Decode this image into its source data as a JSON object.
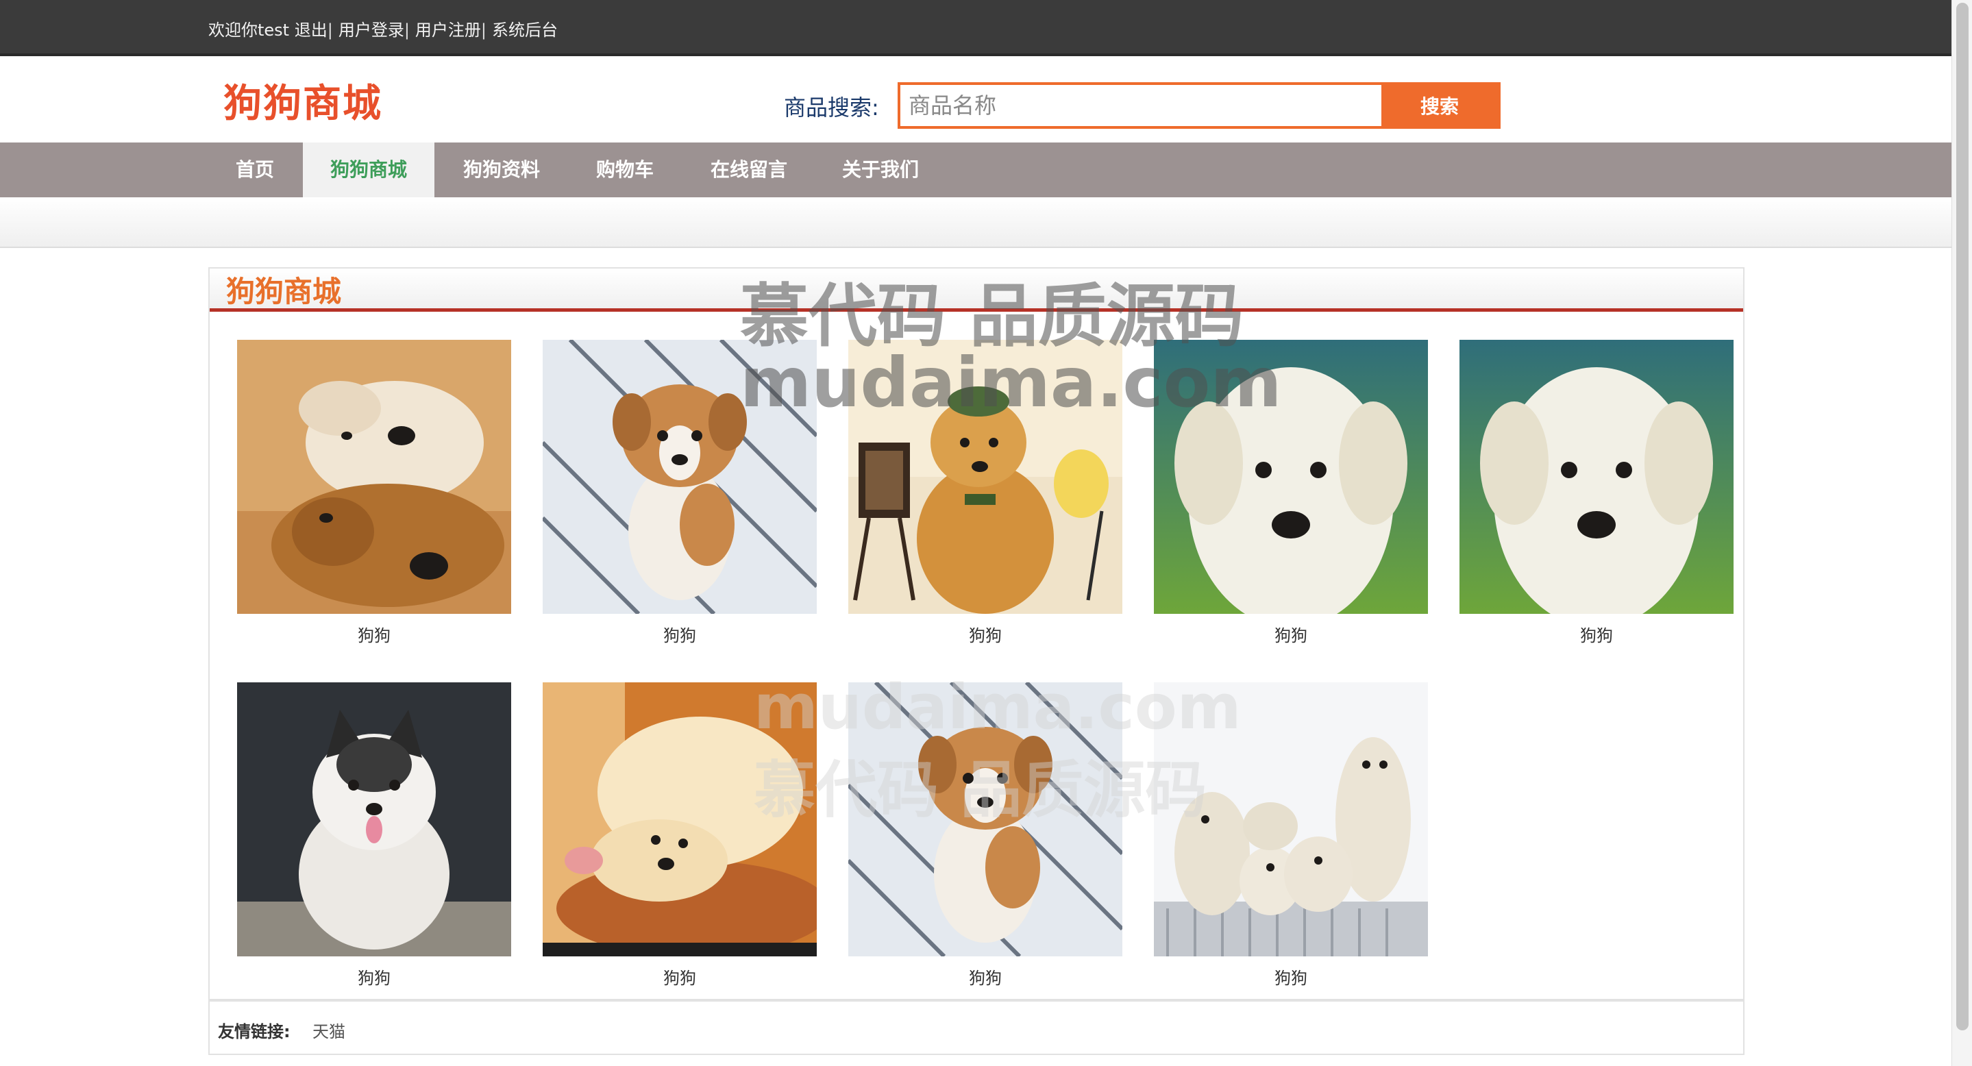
{
  "topbar": {
    "welcome": "欢迎你test",
    "logout": "退出",
    "login": "用户登录",
    "register": "用户注册",
    "admin": "系统后台",
    "separator": "|"
  },
  "header": {
    "logo": "狗狗商城",
    "search_label": "商品搜索:",
    "search_placeholder": "商品名称",
    "search_value": "",
    "search_button": "搜索"
  },
  "nav": {
    "items": [
      {
        "label": "首页",
        "active": false
      },
      {
        "label": "狗狗商城",
        "active": true
      },
      {
        "label": "狗狗资料",
        "active": false
      },
      {
        "label": "购物车",
        "active": false
      },
      {
        "label": "在线留言",
        "active": false
      },
      {
        "label": "关于我们",
        "active": false
      }
    ]
  },
  "section": {
    "title": "狗狗商城"
  },
  "products": [
    {
      "name": "狗狗",
      "image": "golden-retrievers-lying-photo"
    },
    {
      "name": "狗狗",
      "image": "corgi-puppy-photo"
    },
    {
      "name": "狗狗",
      "image": "golden-puppy-with-hat-photo"
    },
    {
      "name": "狗狗",
      "image": "white-labrador-puppy-photo"
    },
    {
      "name": "狗狗",
      "image": "white-labrador-puppy-photo"
    },
    {
      "name": "狗狗",
      "image": "husky-puppy-photo"
    },
    {
      "name": "狗狗",
      "image": "fluffy-puppy-on-wood-photo"
    },
    {
      "name": "狗狗",
      "image": "corgi-puppy-photo"
    },
    {
      "name": "狗狗",
      "image": "labrador-puppies-group-photo"
    }
  ],
  "footer": {
    "links_label": "友情链接:",
    "links": [
      "天猫"
    ]
  },
  "watermark": {
    "line1": "慕代码 品质源码",
    "line2": "mudaima.com"
  },
  "colors": {
    "accent": "#ef6b2c",
    "logo": "#e8502b",
    "nav_bg": "#9c9292",
    "nav_active_text": "#3e9e5a",
    "section_rule": "#b63227",
    "topbar_bg": "#3b3b3b"
  }
}
